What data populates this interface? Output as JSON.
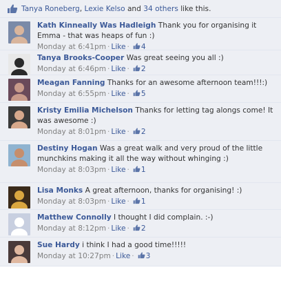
{
  "likes_bar": {
    "names": [
      "Tanya Roneberg",
      "Lexie Kelso"
    ],
    "separator": ", ",
    "and_text": " and ",
    "others_link": "34 others",
    "suffix": " like this.",
    "icon": "thumbs-up-icon"
  },
  "comments": [
    {
      "author": "Kath Kinneally Was Hadleigh",
      "text": "Thank you for organising it Emma - that was heaps of fun :)",
      "time": "Monday at 6:41pm",
      "like_label": "Like",
      "like_count": "4",
      "avatar_colors": [
        "#7a8aa8",
        "#d9b59c"
      ]
    },
    {
      "author": "Tanya Brooks-Cooper",
      "text": "Was great seeing you all :)",
      "time": "Monday at 6:46pm",
      "like_label": "Like",
      "like_count": "2",
      "avatar_colors": [
        "#e8e8e8",
        "#2a2a2a"
      ]
    },
    {
      "author": "Meagan Fanning",
      "text": "Thanks for an awesome afternoon team!!!:)",
      "time": "Monday at 6:55pm",
      "like_label": "Like",
      "like_count": "5",
      "avatar_colors": [
        "#6a4a5a",
        "#c89a8a"
      ]
    },
    {
      "author": "Kristy Emilia Michelson",
      "text": "Thanks for letting tag alongs come! It was awesome :)",
      "time": "Monday at 8:01pm",
      "like_label": "Like",
      "like_count": "2",
      "avatar_colors": [
        "#3a3a3a",
        "#d6a88c"
      ]
    },
    {
      "author": "Destiny Hogan",
      "text": "Was a great walk and very proud of the little munchkins making it all the way without whinging :)",
      "time": "Monday at 8:03pm",
      "like_label": "Like",
      "like_count": "1",
      "avatar_colors": [
        "#8fb3d0",
        "#c68e6c"
      ]
    },
    {
      "author": "Lisa Monks",
      "text": "A great afternoon, thanks for organising! :)",
      "time": "Monday at 8:03pm",
      "like_label": "Like",
      "like_count": "1",
      "avatar_colors": [
        "#3a2a1a",
        "#d9a640"
      ]
    },
    {
      "author": "Matthew Connolly",
      "text": "I thought I did complain. :-)",
      "time": "Monday at 8:12pm",
      "like_label": "Like",
      "like_count": "2",
      "avatar_colors": [
        "#c8cfe0",
        "#ffffff"
      ]
    },
    {
      "author": "Sue Hardy",
      "text": "i think I had a good time!!!!!",
      "time": "Monday at 10:27pm",
      "like_label": "Like",
      "like_count": "3",
      "avatar_colors": [
        "#4a3a3a",
        "#e0b8a0"
      ]
    }
  ],
  "colors": {
    "link": "#3b5998",
    "background": "#edeff4",
    "divider": "#e2e6ef",
    "meta": "#808080"
  }
}
